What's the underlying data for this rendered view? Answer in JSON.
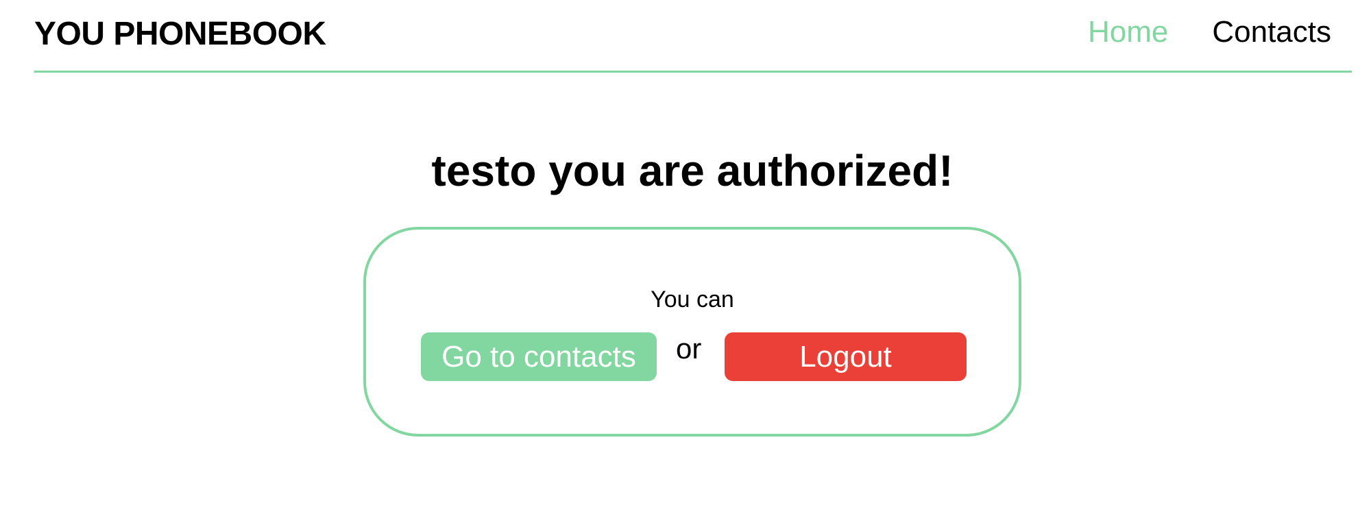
{
  "header": {
    "logo": "YOU PHONEBOOK",
    "nav": [
      {
        "label": "Home",
        "active": true
      },
      {
        "label": "Contacts",
        "active": false
      }
    ]
  },
  "main": {
    "title": "testo you are authorized!",
    "card": {
      "label": "You can",
      "contacts_button": "Go to contacts",
      "or_text": "or",
      "logout_button": "Logout"
    }
  },
  "colors": {
    "accent": "#82d7a0",
    "danger": "#eb4037"
  }
}
